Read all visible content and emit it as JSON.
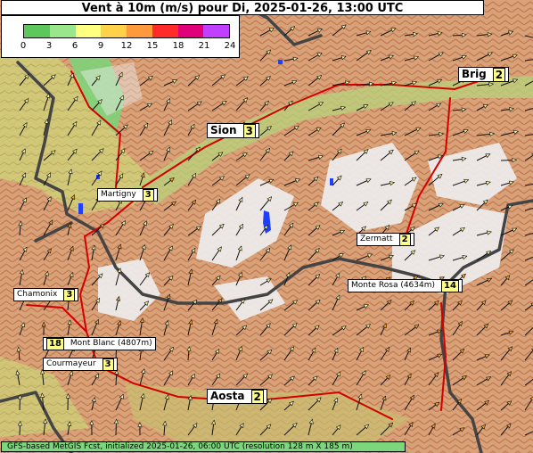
{
  "title": "Vent à 10m (m/s) pour Di, 2025-01-26, 13:00 UTC",
  "legend": {
    "ticks": [
      "0",
      "3",
      "6",
      "9",
      "12",
      "15",
      "18",
      "21",
      "24"
    ],
    "colors": [
      "#5cc85c",
      "#9ae68a",
      "#ffff80",
      "#ffd24a",
      "#ff9a3c",
      "#ff2b2b",
      "#e0007a",
      "#c040ff",
      "#a010e0",
      "#7a0a7a"
    ]
  },
  "places": [
    {
      "name": "Brig",
      "value": "2",
      "big": true
    },
    {
      "name": "Sion",
      "value": "3",
      "big": true
    },
    {
      "name": "Martigny",
      "value": "3",
      "big": false
    },
    {
      "name": "Zermatt",
      "value": "2",
      "big": false
    },
    {
      "name": "Monte Rosa (4634m)",
      "value": "14",
      "big": false
    },
    {
      "name": "Chamonix",
      "value": "3",
      "big": false
    },
    {
      "name": "Mont Blanc (4807m)",
      "value": "18",
      "big": false
    },
    {
      "name": "Courmayeur",
      "value": "3",
      "big": false
    },
    {
      "name": "Aosta",
      "value": "2",
      "big": true
    }
  ],
  "footer": "GFS-based MetGIS Fcst, initialized 2025-01-26, 06:00 UTC  (resolution 128 m X 185 m)"
}
